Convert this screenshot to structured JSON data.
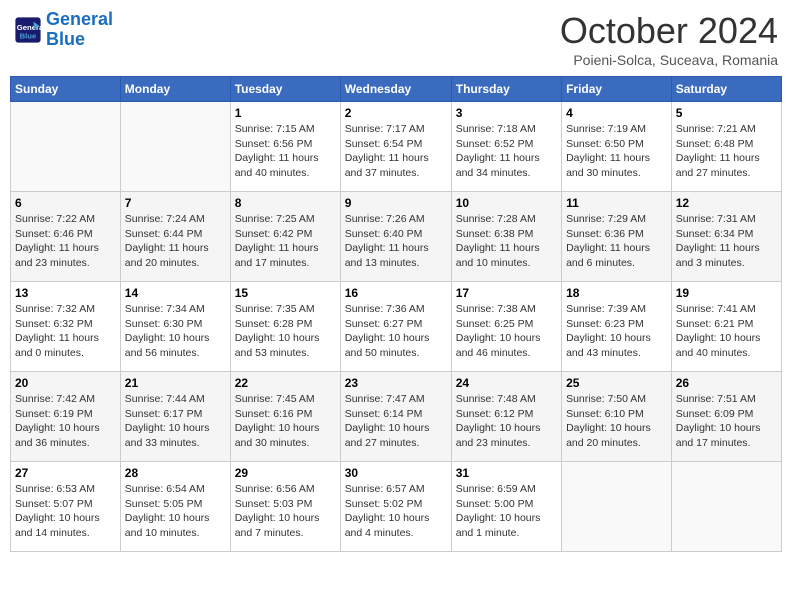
{
  "header": {
    "logo_line1": "General",
    "logo_line2": "Blue",
    "month_title": "October 2024",
    "subtitle": "Poieni-Solca, Suceava, Romania"
  },
  "weekdays": [
    "Sunday",
    "Monday",
    "Tuesday",
    "Wednesday",
    "Thursday",
    "Friday",
    "Saturday"
  ],
  "weeks": [
    [
      {
        "day": "",
        "info": ""
      },
      {
        "day": "",
        "info": ""
      },
      {
        "day": "1",
        "info": "Sunrise: 7:15 AM\nSunset: 6:56 PM\nDaylight: 11 hours and 40 minutes."
      },
      {
        "day": "2",
        "info": "Sunrise: 7:17 AM\nSunset: 6:54 PM\nDaylight: 11 hours and 37 minutes."
      },
      {
        "day": "3",
        "info": "Sunrise: 7:18 AM\nSunset: 6:52 PM\nDaylight: 11 hours and 34 minutes."
      },
      {
        "day": "4",
        "info": "Sunrise: 7:19 AM\nSunset: 6:50 PM\nDaylight: 11 hours and 30 minutes."
      },
      {
        "day": "5",
        "info": "Sunrise: 7:21 AM\nSunset: 6:48 PM\nDaylight: 11 hours and 27 minutes."
      }
    ],
    [
      {
        "day": "6",
        "info": "Sunrise: 7:22 AM\nSunset: 6:46 PM\nDaylight: 11 hours and 23 minutes."
      },
      {
        "day": "7",
        "info": "Sunrise: 7:24 AM\nSunset: 6:44 PM\nDaylight: 11 hours and 20 minutes."
      },
      {
        "day": "8",
        "info": "Sunrise: 7:25 AM\nSunset: 6:42 PM\nDaylight: 11 hours and 17 minutes."
      },
      {
        "day": "9",
        "info": "Sunrise: 7:26 AM\nSunset: 6:40 PM\nDaylight: 11 hours and 13 minutes."
      },
      {
        "day": "10",
        "info": "Sunrise: 7:28 AM\nSunset: 6:38 PM\nDaylight: 11 hours and 10 minutes."
      },
      {
        "day": "11",
        "info": "Sunrise: 7:29 AM\nSunset: 6:36 PM\nDaylight: 11 hours and 6 minutes."
      },
      {
        "day": "12",
        "info": "Sunrise: 7:31 AM\nSunset: 6:34 PM\nDaylight: 11 hours and 3 minutes."
      }
    ],
    [
      {
        "day": "13",
        "info": "Sunrise: 7:32 AM\nSunset: 6:32 PM\nDaylight: 11 hours and 0 minutes."
      },
      {
        "day": "14",
        "info": "Sunrise: 7:34 AM\nSunset: 6:30 PM\nDaylight: 10 hours and 56 minutes."
      },
      {
        "day": "15",
        "info": "Sunrise: 7:35 AM\nSunset: 6:28 PM\nDaylight: 10 hours and 53 minutes."
      },
      {
        "day": "16",
        "info": "Sunrise: 7:36 AM\nSunset: 6:27 PM\nDaylight: 10 hours and 50 minutes."
      },
      {
        "day": "17",
        "info": "Sunrise: 7:38 AM\nSunset: 6:25 PM\nDaylight: 10 hours and 46 minutes."
      },
      {
        "day": "18",
        "info": "Sunrise: 7:39 AM\nSunset: 6:23 PM\nDaylight: 10 hours and 43 minutes."
      },
      {
        "day": "19",
        "info": "Sunrise: 7:41 AM\nSunset: 6:21 PM\nDaylight: 10 hours and 40 minutes."
      }
    ],
    [
      {
        "day": "20",
        "info": "Sunrise: 7:42 AM\nSunset: 6:19 PM\nDaylight: 10 hours and 36 minutes."
      },
      {
        "day": "21",
        "info": "Sunrise: 7:44 AM\nSunset: 6:17 PM\nDaylight: 10 hours and 33 minutes."
      },
      {
        "day": "22",
        "info": "Sunrise: 7:45 AM\nSunset: 6:16 PM\nDaylight: 10 hours and 30 minutes."
      },
      {
        "day": "23",
        "info": "Sunrise: 7:47 AM\nSunset: 6:14 PM\nDaylight: 10 hours and 27 minutes."
      },
      {
        "day": "24",
        "info": "Sunrise: 7:48 AM\nSunset: 6:12 PM\nDaylight: 10 hours and 23 minutes."
      },
      {
        "day": "25",
        "info": "Sunrise: 7:50 AM\nSunset: 6:10 PM\nDaylight: 10 hours and 20 minutes."
      },
      {
        "day": "26",
        "info": "Sunrise: 7:51 AM\nSunset: 6:09 PM\nDaylight: 10 hours and 17 minutes."
      }
    ],
    [
      {
        "day": "27",
        "info": "Sunrise: 6:53 AM\nSunset: 5:07 PM\nDaylight: 10 hours and 14 minutes."
      },
      {
        "day": "28",
        "info": "Sunrise: 6:54 AM\nSunset: 5:05 PM\nDaylight: 10 hours and 10 minutes."
      },
      {
        "day": "29",
        "info": "Sunrise: 6:56 AM\nSunset: 5:03 PM\nDaylight: 10 hours and 7 minutes."
      },
      {
        "day": "30",
        "info": "Sunrise: 6:57 AM\nSunset: 5:02 PM\nDaylight: 10 hours and 4 minutes."
      },
      {
        "day": "31",
        "info": "Sunrise: 6:59 AM\nSunset: 5:00 PM\nDaylight: 10 hours and 1 minute."
      },
      {
        "day": "",
        "info": ""
      },
      {
        "day": "",
        "info": ""
      }
    ]
  ]
}
